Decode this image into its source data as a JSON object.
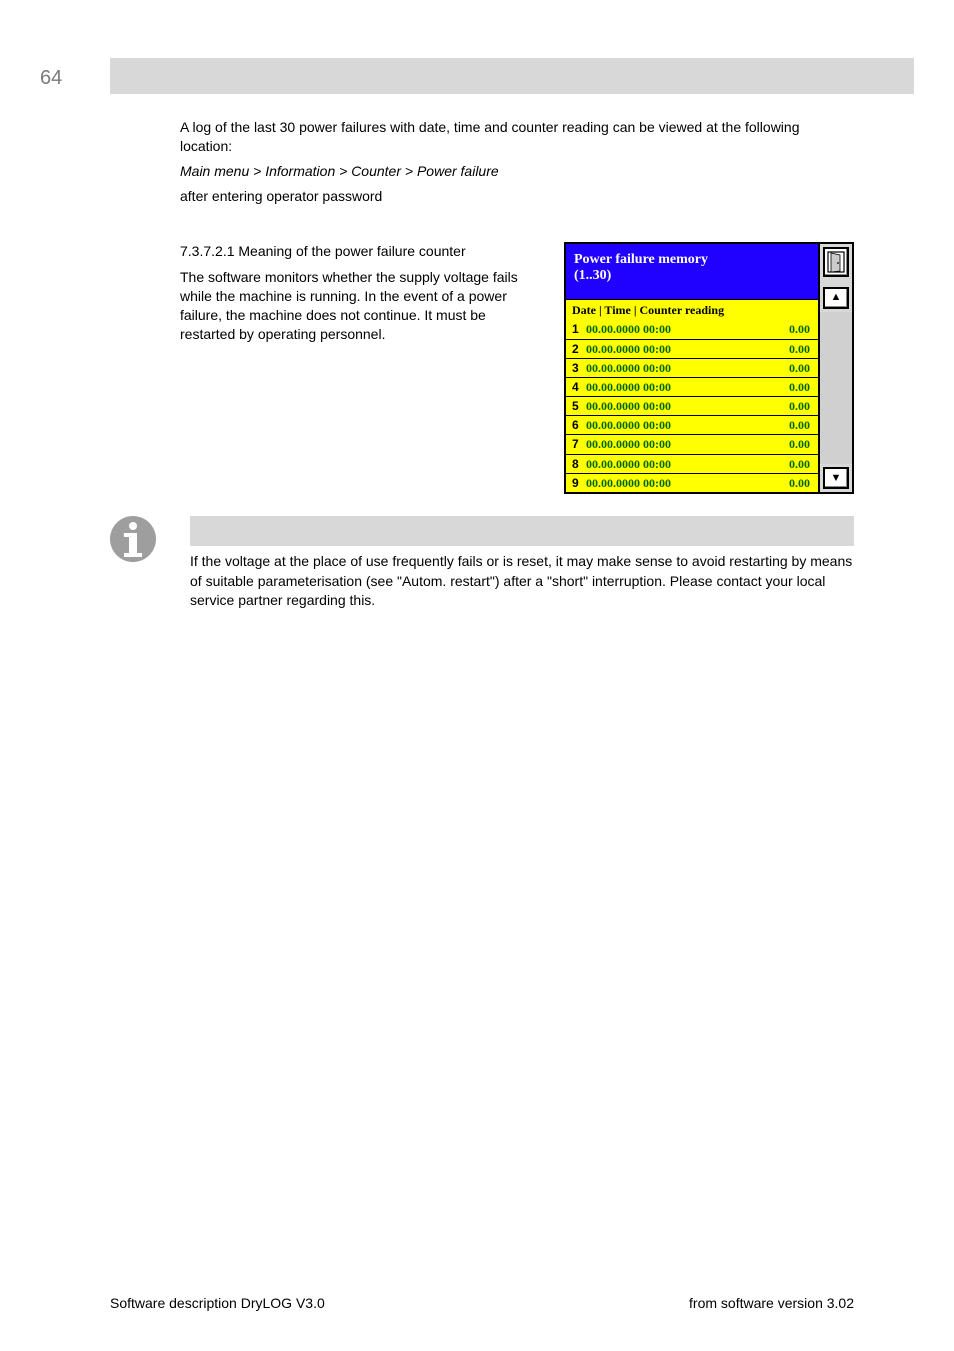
{
  "header": {
    "page_number": "64"
  },
  "intro": {
    "line1": "A log of the last 30 power failures with date, time and counter reading can be viewed at the following location:",
    "menu_path": "Main menu > Information > Counter > Power failure",
    "line2": "after entering operator password"
  },
  "hmi": {
    "title_line1": "Power failure memory",
    "title_line2": "(1..30)",
    "subtitle": "Date | Time | Counter reading",
    "rows": [
      {
        "idx": "1",
        "datetime": "00.00.0000  00:00",
        "value": "0.00"
      },
      {
        "idx": "2",
        "datetime": "00.00.0000  00:00",
        "value": "0.00"
      },
      {
        "idx": "3",
        "datetime": "00.00.0000  00:00",
        "value": "0.00"
      },
      {
        "idx": "4",
        "datetime": "00.00.0000  00:00",
        "value": "0.00"
      },
      {
        "idx": "5",
        "datetime": "00.00.0000  00:00",
        "value": "0.00"
      },
      {
        "idx": "6",
        "datetime": "00.00.0000  00:00",
        "value": "0.00"
      },
      {
        "idx": "7",
        "datetime": "00.00.0000  00:00",
        "value": "0.00"
      },
      {
        "idx": "8",
        "datetime": "00.00.0000  00:00",
        "value": "0.00"
      },
      {
        "idx": "9",
        "datetime": "00.00.0000  00:00",
        "value": "0.00"
      }
    ]
  },
  "left_column": {
    "heading": "7.3.7.2.1 Meaning of the power failure counter",
    "body": "The software monitors whether the supply voltage fails while the machine is running. In the event of a power failure, the machine does not continue. It must be restarted by operating personnel."
  },
  "info": {
    "body": "If the voltage at the place of use frequently fails or is reset, it may make sense to avoid restarting by means of suitable parameterisation (see \"Autom. restart\") after a \"short\" interruption. Please contact your local service partner regarding this."
  },
  "footer": {
    "left": "Software description DryLOG V3.0",
    "right": "from software version 3.02"
  }
}
